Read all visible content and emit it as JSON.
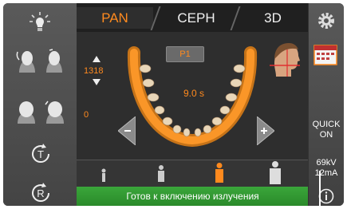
{
  "tabs": [
    {
      "label": "PAN",
      "active": true
    },
    {
      "label": "CEPH",
      "active": false
    },
    {
      "label": "3D",
      "active": false
    }
  ],
  "program": {
    "label": "P1"
  },
  "scan_time": "9.0 s",
  "height_value": "1318",
  "offset_value": "0",
  "right": {
    "quick_line1": "QUICK",
    "quick_line2": "ON",
    "kv": "69kV",
    "ma": "12mA"
  },
  "status": "Готов к включению излучения",
  "patient_sizes": [
    "child",
    "small",
    "medium",
    "large"
  ],
  "selected_patient_size": 2,
  "colors": {
    "accent": "#ff8a1e",
    "status_green": "#2f9a2f",
    "panel": "#4a4a4a"
  },
  "icons": [
    "lamp-icon",
    "head-tilt-icon",
    "head-profile-icon",
    "rotate-t-icon",
    "rotate-r-icon",
    "settings-icon",
    "calendar-icon",
    "info-icon",
    "arrow-left-icon",
    "arrow-right-icon",
    "arrow-up-icon",
    "arrow-down-icon"
  ]
}
